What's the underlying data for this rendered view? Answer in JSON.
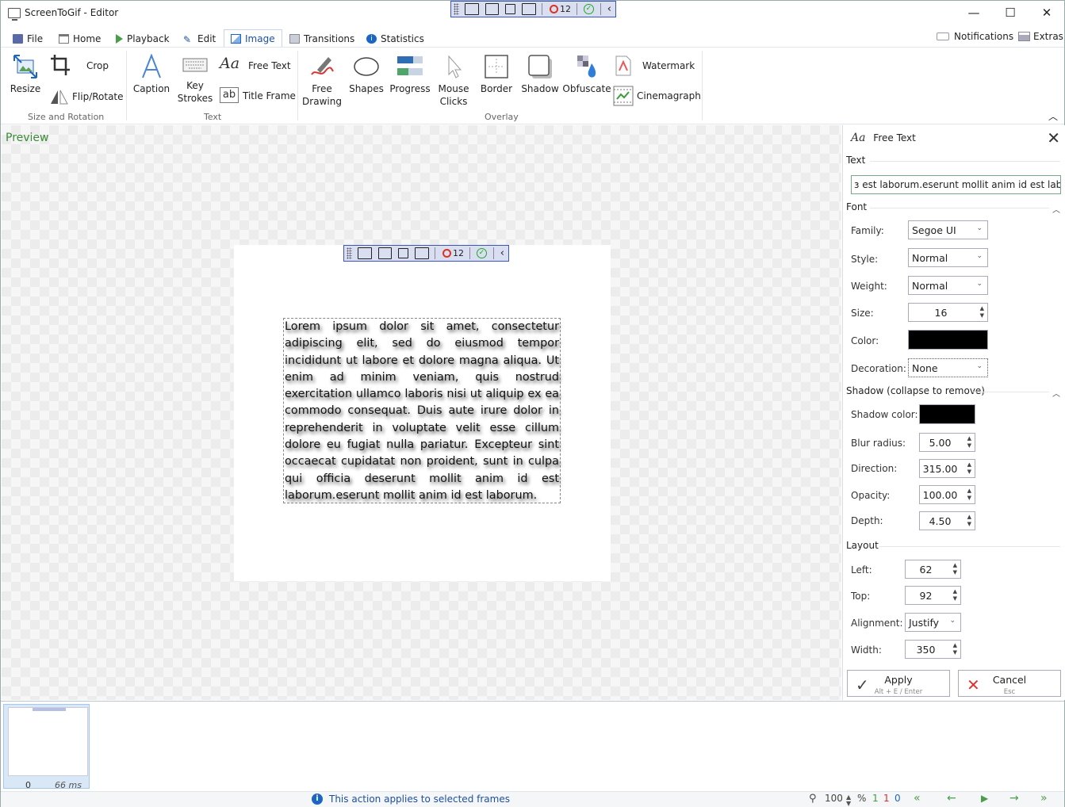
{
  "window": {
    "title": "ScreenToGif - Editor"
  },
  "recorder_bar": {
    "count": "12"
  },
  "tabs": [
    {
      "label": "File"
    },
    {
      "label": "Home"
    },
    {
      "label": "Playback"
    },
    {
      "label": "Edit"
    },
    {
      "label": "Image"
    },
    {
      "label": "Transitions"
    },
    {
      "label": "Statistics"
    }
  ],
  "top_right": {
    "notifications": "Notifications",
    "extras": "Extras"
  },
  "ribbon": {
    "resize": "Resize",
    "crop": "Crop",
    "flip_rotate": "Flip/Rotate",
    "group_size": "Size and Rotation",
    "caption": "Caption",
    "key_strokes_1": "Key",
    "key_strokes_2": "Strokes",
    "free_text": "Free Text",
    "title_frame": "Title Frame",
    "group_text": "Text",
    "free_drawing_1": "Free",
    "free_drawing_2": "Drawing",
    "shapes": "Shapes",
    "progress": "Progress",
    "mouse_clicks_1": "Mouse",
    "mouse_clicks_2": "Clicks",
    "border": "Border",
    "shadow": "Shadow",
    "obfuscate": "Obfuscate",
    "watermark": "Watermark",
    "cinemagraph": "Cinemagraph",
    "group_overlay": "Overlay"
  },
  "preview": {
    "label": "Preview",
    "text": "Lorem ipsum dolor sit amet, consectetur adipiscing elit, sed do eiusmod tempor incididunt ut labore et dolore magna aliqua. Ut enim ad minim veniam, quis nostrud exercitation ullamco laboris nisi ut aliquip ex ea commodo consequat. Duis aute irure dolor in reprehenderit in voluptate velit esse cillum dolore eu fugiat nulla pariatur. Excepteur sint occaecat cupidatat non proident, sunt in culpa qui officia deserunt mollit anim id est laborum.eserunt mollit anim id est laborum."
  },
  "panel": {
    "title": "Free Text",
    "text_section": "Text",
    "text_value": "ɜ est laborum.eserunt mollit anim id est laborum.",
    "font_section": "Font",
    "family_label": "Family:",
    "family_value": "Segoe UI",
    "style_label": "Style:",
    "style_value": "Normal",
    "weight_label": "Weight:",
    "weight_value": "Normal",
    "size_label": "Size:",
    "size_value": "16",
    "color_label": "Color:",
    "color_value": "#000000",
    "decoration_label": "Decoration:",
    "decoration_value": "None",
    "shadow_section": "Shadow (collapse to remove)",
    "shadow_color_label": "Shadow color:",
    "shadow_color_value": "#000000",
    "blur_label": "Blur radius:",
    "blur_value": "5.00",
    "direction_label": "Direction:",
    "direction_value": "315.00",
    "opacity_label": "Opacity:",
    "opacity_value": "100.00",
    "depth_label": "Depth:",
    "depth_value": "4.50",
    "layout_section": "Layout",
    "left_label": "Left:",
    "left_value": "62",
    "top_label": "Top:",
    "top_value": "92",
    "alignment_label": "Alignment:",
    "alignment_value": "Justify",
    "width_label": "Width:",
    "width_value": "350",
    "apply_label": "Apply",
    "apply_shortcut": "Alt + E / Enter",
    "cancel_label": "Cancel",
    "cancel_shortcut": "Esc"
  },
  "frames": [
    {
      "index": "0",
      "duration": "66 ms"
    }
  ],
  "statusbar": {
    "message": "This action applies to selected frames",
    "zoom": "100",
    "zoom_unit": "%",
    "count_total": "1",
    "count_selected": "1",
    "count_other": "0"
  },
  "colors": {
    "accent": "#1b4f9e",
    "preview_label": "#3b8a3b",
    "selected_count": "#d32f2f"
  }
}
